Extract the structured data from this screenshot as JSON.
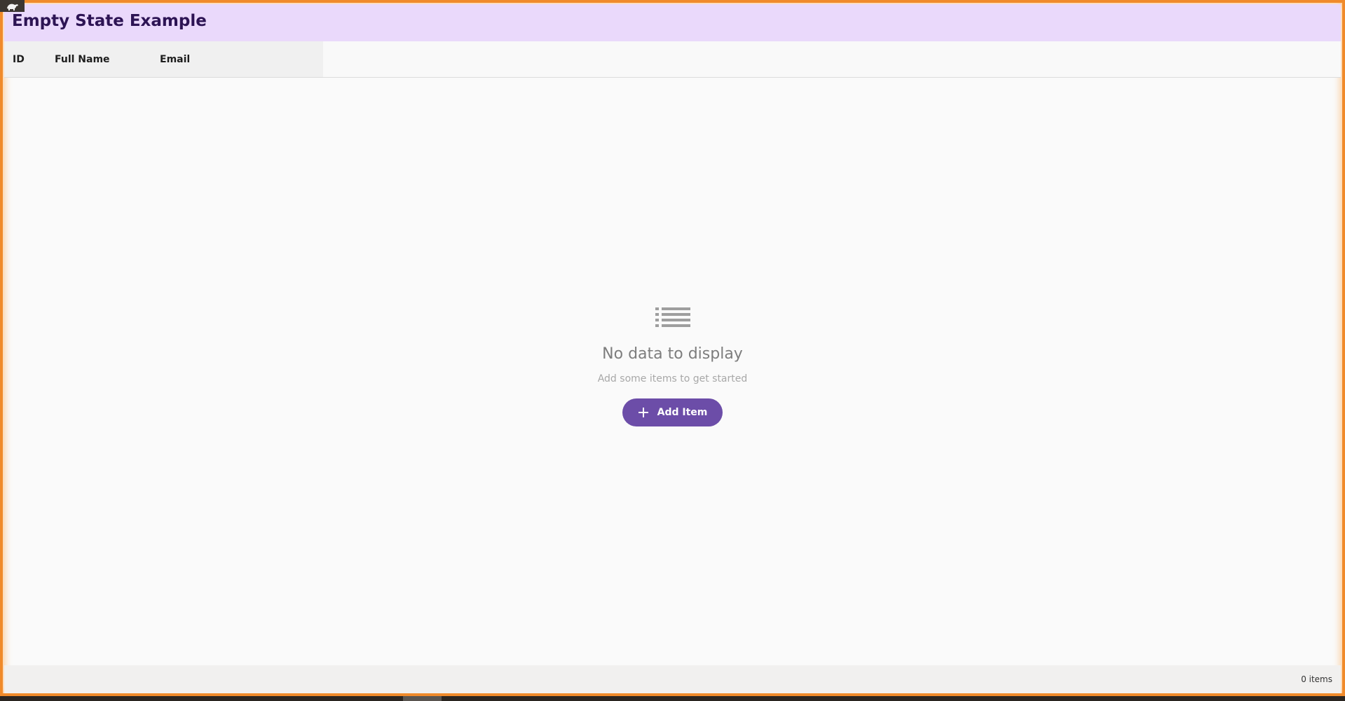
{
  "window": {
    "title": "Empty State Example",
    "app_icon": "turtle-icon"
  },
  "table": {
    "columns": [
      "ID",
      "Full Name",
      "Email"
    ]
  },
  "empty_state": {
    "icon": "list-icon",
    "title": "No data to display",
    "subtitle": "Add some items to get started",
    "button_label": "Add Item",
    "button_icon": "plus-icon"
  },
  "status": {
    "item_count": "0 items"
  },
  "colors": {
    "accent": "#6c4da8",
    "title_bar": "#ead9fb",
    "title_text": "#2d1454",
    "frame_border": "#f08a2a"
  }
}
